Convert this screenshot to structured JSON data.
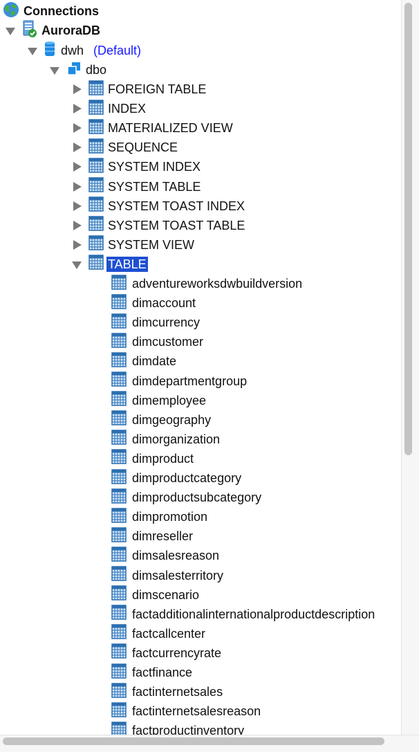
{
  "tree": {
    "root": {
      "label": "Connections",
      "icon": "globe-icon"
    },
    "connection": {
      "label": "AuroraDB",
      "icon": "database-server-connected-icon"
    },
    "database": {
      "label": "dwh",
      "suffix": "(Default)",
      "icon": "database-icon"
    },
    "schema": {
      "label": "dbo",
      "icon": "schema-icon"
    },
    "folders": [
      {
        "label": "FOREIGN TABLE",
        "expanded": false
      },
      {
        "label": "INDEX",
        "expanded": false
      },
      {
        "label": "MATERIALIZED VIEW",
        "expanded": false
      },
      {
        "label": "SEQUENCE",
        "expanded": false
      },
      {
        "label": "SYSTEM INDEX",
        "expanded": false
      },
      {
        "label": "SYSTEM TABLE",
        "expanded": false
      },
      {
        "label": "SYSTEM TOAST INDEX",
        "expanded": false
      },
      {
        "label": "SYSTEM TOAST TABLE",
        "expanded": false
      },
      {
        "label": "SYSTEM VIEW",
        "expanded": false
      },
      {
        "label": "TABLE",
        "expanded": true,
        "selected": true
      }
    ],
    "tables": [
      "adventureworksdwbuildversion",
      "dimaccount",
      "dimcurrency",
      "dimcustomer",
      "dimdate",
      "dimdepartmentgroup",
      "dimemployee",
      "dimgeography",
      "dimorganization",
      "dimproduct",
      "dimproductcategory",
      "dimproductsubcategory",
      "dimpromotion",
      "dimreseller",
      "dimsalesreason",
      "dimsalesterritory",
      "dimscenario",
      "factadditionalinternationalproductdescription",
      "factcallcenter",
      "factcurrencyrate",
      "factfinance",
      "factinternetsales",
      "factinternetsalesreason",
      "factproductinventory"
    ]
  },
  "colors": {
    "selection": "#1f4fd1",
    "default_tag": "#1a1aff",
    "grid_icon_border": "#2c6fb0",
    "grid_icon_fill": "#cfe6fb"
  },
  "scroll": {
    "vertical_position": 0.0,
    "horizontal_position": 0.0
  }
}
